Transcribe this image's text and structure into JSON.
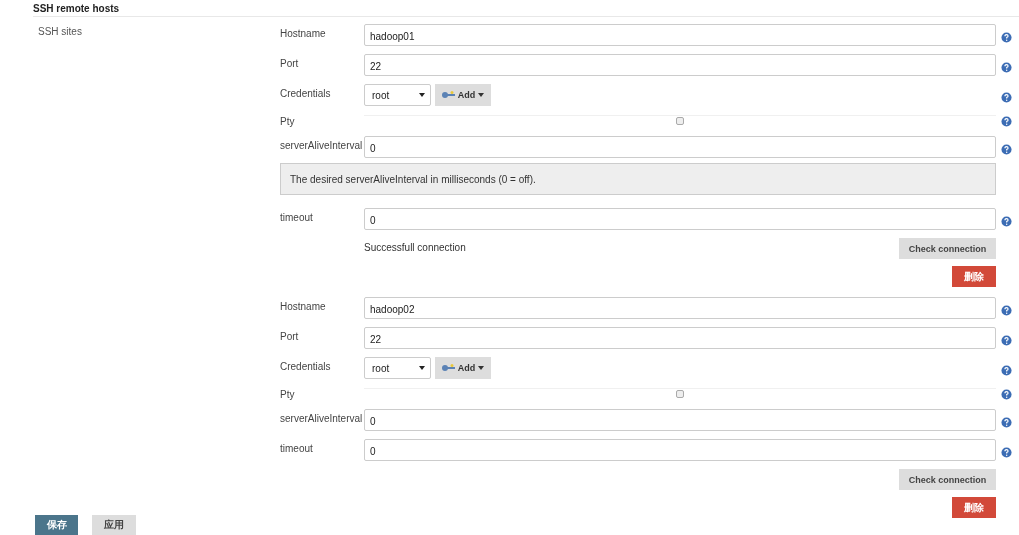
{
  "section": {
    "title": "SSH remote hosts",
    "label": "SSH sites"
  },
  "sites": [
    {
      "fields": [
        {
          "kind": "text",
          "label": "Hostname",
          "value": "hadoop01"
        },
        {
          "kind": "text",
          "label": "Port",
          "value": "22"
        },
        {
          "kind": "credentials",
          "label": "Credentials",
          "value": "root",
          "add": "Add"
        },
        {
          "kind": "checkbox",
          "label": "Pty",
          "checked": false
        },
        {
          "kind": "text",
          "label": "serverAliveInterval",
          "value": "0"
        },
        {
          "kind": "help",
          "text": "The desired serverAliveInterval in milliseconds (0 = off)."
        },
        {
          "kind": "text",
          "label": "timeout",
          "value": "0"
        }
      ],
      "status": "Successfull connection",
      "check": "Check connection",
      "delete": "删除"
    },
    {
      "fields": [
        {
          "kind": "text",
          "label": "Hostname",
          "value": "hadoop02"
        },
        {
          "kind": "text",
          "label": "Port",
          "value": "22"
        },
        {
          "kind": "credentials",
          "label": "Credentials",
          "value": "root",
          "add": "Add"
        },
        {
          "kind": "checkbox",
          "label": "Pty",
          "checked": false
        },
        {
          "kind": "text",
          "label": "serverAliveInterval",
          "value": "0"
        },
        {
          "kind": "text",
          "label": "timeout",
          "value": "0"
        }
      ],
      "check": "Check connection",
      "delete": "删除"
    }
  ],
  "footer": {
    "save": "保存",
    "apply": "应用"
  }
}
